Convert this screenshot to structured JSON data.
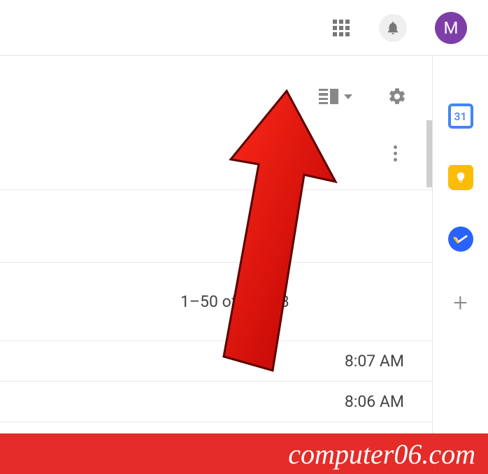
{
  "header": {
    "avatar_initial": "M"
  },
  "toolbar": {
    "split_toggle": "split-pane",
    "settings": "Settings"
  },
  "paging": {
    "range_text": "1–50 of 82,598"
  },
  "rows": {
    "r1_time": "8:07 AM",
    "r2_time": "8:06 AM"
  },
  "sidepanel": {
    "calendar_day": "31"
  },
  "watermark": {
    "text": "computer06.com"
  }
}
